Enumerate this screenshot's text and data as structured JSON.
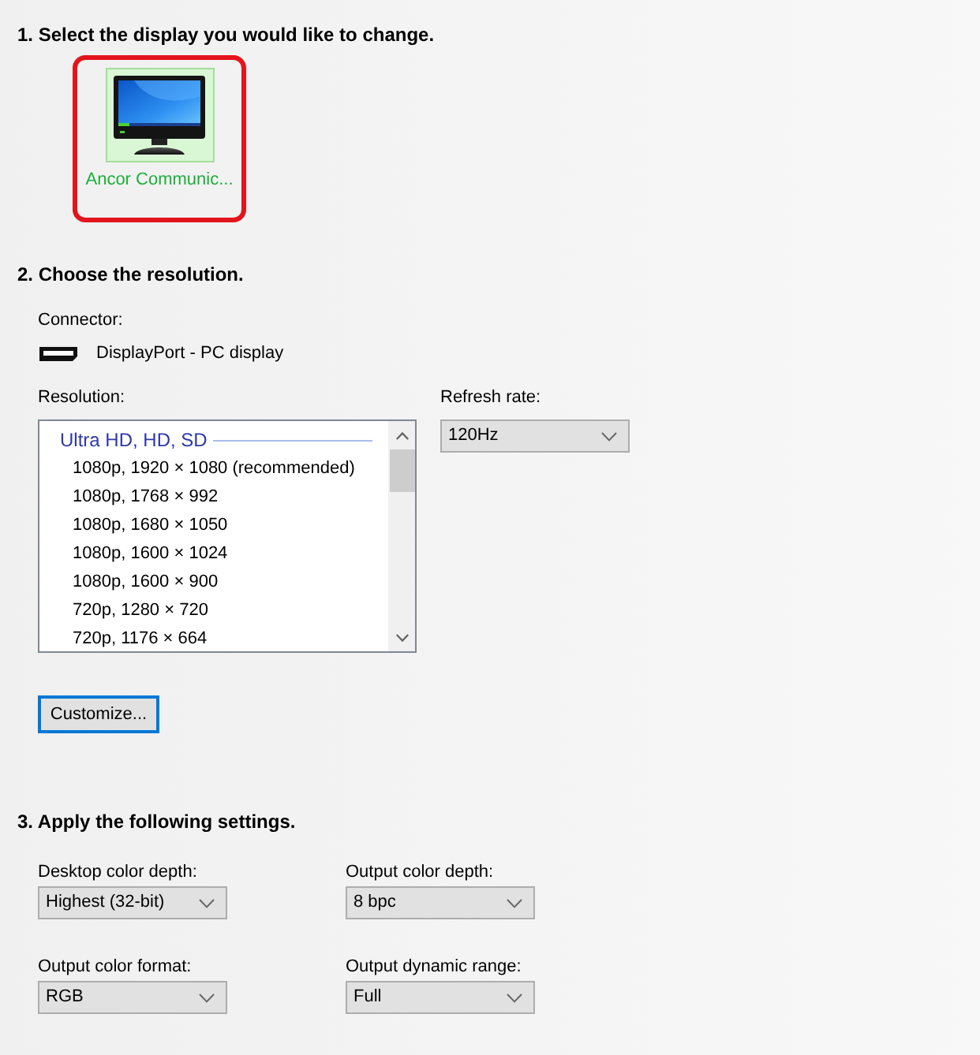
{
  "step1": {
    "heading": "1. Select the display you would like to change.",
    "displays": [
      {
        "label": "Ancor Communic...",
        "selected": true,
        "highlighted": true
      }
    ]
  },
  "step2": {
    "heading": "2. Choose the resolution.",
    "connector": {
      "label": "Connector:",
      "value": "DisplayPort - PC display"
    },
    "resolution": {
      "label": "Resolution:",
      "groups": [
        {
          "title": "Ultra HD, HD, SD",
          "items": [
            {
              "text": "1080p, 1920 × 1080 (recommended)",
              "selected": false
            },
            {
              "text": "1080p, 1768 × 992",
              "selected": false
            },
            {
              "text": "1080p, 1680 × 1050",
              "selected": false
            },
            {
              "text": "1080p, 1600 × 1024",
              "selected": false
            },
            {
              "text": "1080p, 1600 × 900",
              "selected": false
            },
            {
              "text": "720p, 1280 × 720",
              "selected": false
            },
            {
              "text": "720p, 1176 × 664",
              "selected": false
            }
          ]
        }
      ]
    },
    "refresh_rate": {
      "label": "Refresh rate:",
      "value": "120Hz"
    },
    "customize_button": {
      "label": "Customize...",
      "focused": true
    }
  },
  "step3": {
    "heading": "3. Apply the following settings.",
    "settings": [
      {
        "label": "Desktop color depth:",
        "value": "Highest (32-bit)"
      },
      {
        "label": "Output color depth:",
        "value": "8 bpc"
      },
      {
        "label": "Output color format:",
        "value": "RGB"
      },
      {
        "label": "Output dynamic range:",
        "value": "Full"
      }
    ]
  }
}
